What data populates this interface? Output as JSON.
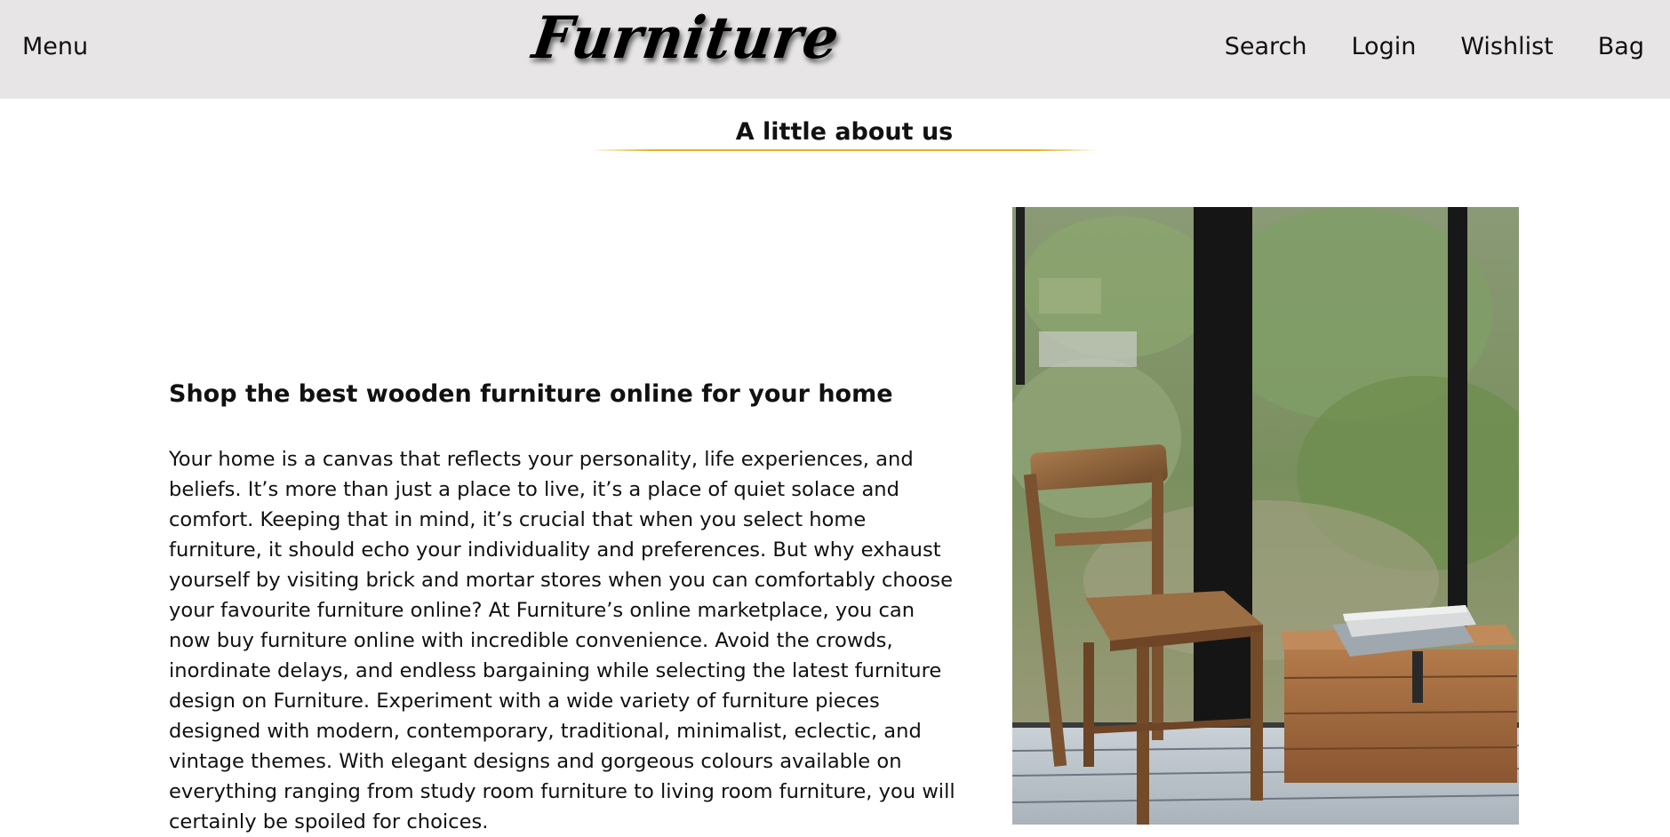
{
  "header": {
    "menu_label": "Menu",
    "logo_text": "Furniture",
    "nav": [
      "Search",
      "Login",
      "Wishlist",
      "Bag"
    ]
  },
  "about": {
    "title": "A little about us",
    "heading": "Shop the best wooden furniture online for your home",
    "body": "Your home is a canvas that reflects your personality, life experiences, and beliefs. It’s more than just a place to live, it’s a place of quiet solace and comfort. Keeping that in mind, it’s crucial that when you select home furniture, it should echo your individuality and preferences. But why exhaust yourself by visiting brick and mortar stores when you can comfortably choose your favourite furniture online? At Furniture’s online marketplace, you can now buy furniture online with incredible convenience. Avoid the crowds, inordinate delays, and endless bargaining while selecting the latest furniture design on Furniture. Experiment with a wide variety of furniture pieces designed with modern, contemporary, traditional, minimalist, eclectic, and vintage themes. With elegant designs and gorgeous colours available on everything ranging from study room furniture to living room furniture, you will certainly be spoiled for choices."
  },
  "colors": {
    "header_bg": "#e7e5e5",
    "accent_rule": "#e2b42a",
    "text": "#111111"
  }
}
